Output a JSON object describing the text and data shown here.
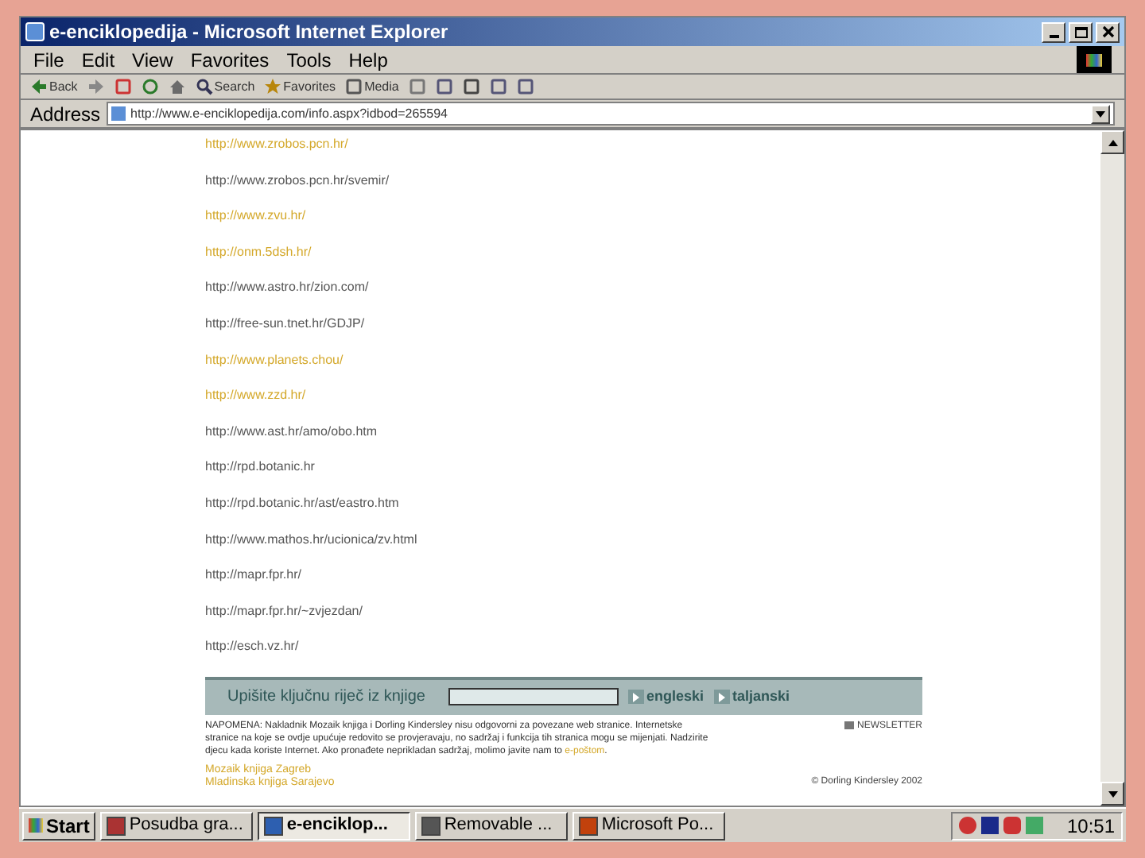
{
  "window": {
    "title": "e-enciklopedija - Microsoft Internet Explorer"
  },
  "menu": [
    "File",
    "Edit",
    "View",
    "Favorites",
    "Tools",
    "Help"
  ],
  "toolbar": [
    {
      "kind": "back",
      "label": "Back"
    },
    {
      "kind": "forward"
    },
    {
      "kind": "stop"
    },
    {
      "kind": "refresh"
    },
    {
      "kind": "home"
    },
    {
      "kind": "search",
      "label": "Search"
    },
    {
      "kind": "favorites",
      "label": "Favorites"
    },
    {
      "kind": "media",
      "label": "Media"
    },
    {
      "kind": "history"
    },
    {
      "kind": "mail"
    },
    {
      "kind": "print"
    },
    {
      "kind": "edit"
    },
    {
      "kind": "discuss"
    }
  ],
  "address": {
    "label": "Address",
    "value": "http://www.e-enciklopedija.com/info.aspx?idbod=265594"
  },
  "links": [
    {
      "text": "http://www.zrobos.pcn.hr/",
      "visited": true
    },
    {
      "text": "http://www.zrobos.pcn.hr/svemir/",
      "visited": false
    },
    {
      "text": "http://www.zvu.hr/",
      "visited": true
    },
    {
      "text": "http://onm.5dsh.hr/",
      "visited": true
    },
    {
      "text": "http://www.astro.hr/zion.com/",
      "visited": false
    },
    {
      "text": "http://free-sun.tnet.hr/GDJP/",
      "visited": false
    },
    {
      "text": "http://www.planets.chou/",
      "visited": true
    },
    {
      "text": "http://www.zzd.hr/",
      "visited": true
    },
    {
      "text": "http://www.ast.hr/amo/obo.htm",
      "visited": false
    },
    {
      "text": "http://rpd.botanic.hr",
      "visited": false
    },
    {
      "text": "http://rpd.botanic.hr/ast/eastro.htm",
      "visited": false
    },
    {
      "text": "http://www.mathos.hr/ucionica/zv.html",
      "visited": false
    },
    {
      "text": "http://mapr.fpr.hr/",
      "visited": false
    },
    {
      "text": "http://mapr.fpr.hr/~zvjezdan/",
      "visited": false
    },
    {
      "text": "http://esch.vz.hr/",
      "visited": false
    }
  ],
  "search_bar": {
    "label": "Upišite ključnu riječ iz knjige",
    "buttons": [
      "engleski",
      "taljanski"
    ]
  },
  "notice": {
    "text": "NAPOMENA: Nakladnik Mozaik knjiga i Dorling Kindersley nisu odgovorni za povezane web stranice. Internetske stranice na koje se ovdje upućuje redovito se provjeravaju, no sadržaj i funkcija tih stranica mogu se mijenjati. Nadzirite djecu kada koriste Internet. Ako pronađete neprikladan sadržaj, molimo javite nam to",
    "link": "e-poštom",
    "end": "."
  },
  "newsletter": "NEWSLETTER",
  "footer_links": [
    "Mozaik knjiga Zagreb",
    "Mladinska knjiga Sarajevo"
  ],
  "copyright": "© Dorling Kindersley 2002",
  "taskbar": {
    "start": "Start",
    "tasks": [
      {
        "label": "Posudba gra...",
        "selected": false,
        "kind": "app"
      },
      {
        "label": "e-enciklop...",
        "selected": true,
        "kind": "ie"
      },
      {
        "label": "Removable ...",
        "selected": false,
        "kind": "drive"
      },
      {
        "label": "Microsoft Po...",
        "selected": false,
        "kind": "ppt"
      }
    ],
    "clock": "10:51"
  }
}
